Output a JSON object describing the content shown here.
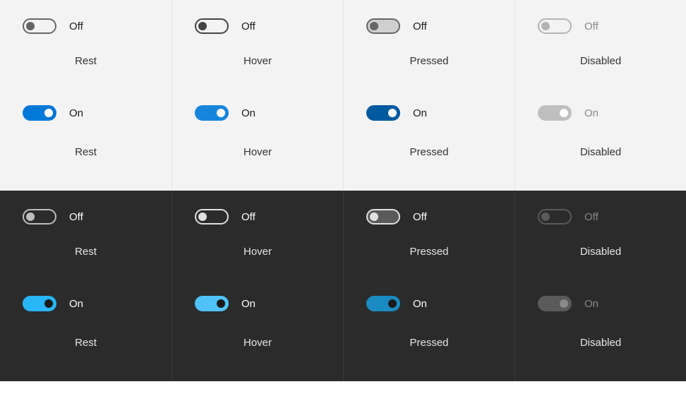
{
  "labels": {
    "off": "Off",
    "on": "On"
  },
  "states": {
    "rest": "Rest",
    "hover": "Hover",
    "pressed": "Pressed",
    "disabled": "Disabled"
  },
  "colors": {
    "light_accent": "#0078d7",
    "dark_accent": "#29b6f6",
    "light_bg": "#f3f3f3",
    "dark_bg": "#2b2b2b"
  }
}
